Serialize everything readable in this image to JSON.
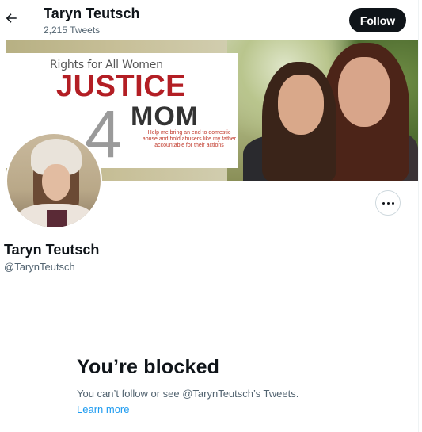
{
  "header": {
    "back_icon": "arrow-left-icon",
    "name": "Taryn Teutsch",
    "tweet_count": "2,215 Tweets",
    "follow_label": "Follow"
  },
  "banner": {
    "rights_text": "Rights for All Women",
    "justice_text": "JUSTICE",
    "four_text": "4",
    "mom_text": "MOM",
    "help_text": "Help me bring an end to domestic abuse and hold abusers like my father accountable for their actions"
  },
  "profile": {
    "more_icon": "more-horizontal-icon",
    "name": "Taryn Teutsch",
    "handle": "@TarynTeutsch"
  },
  "blocked": {
    "title": "You’re blocked",
    "message": "You can’t follow or see @TarynTeutsch’s Tweets.",
    "learn_more": "Learn more"
  },
  "colors": {
    "text": "#0f1419",
    "secondary": "#536471",
    "link": "#1d9bf0",
    "follow_bg": "#0f1419"
  }
}
